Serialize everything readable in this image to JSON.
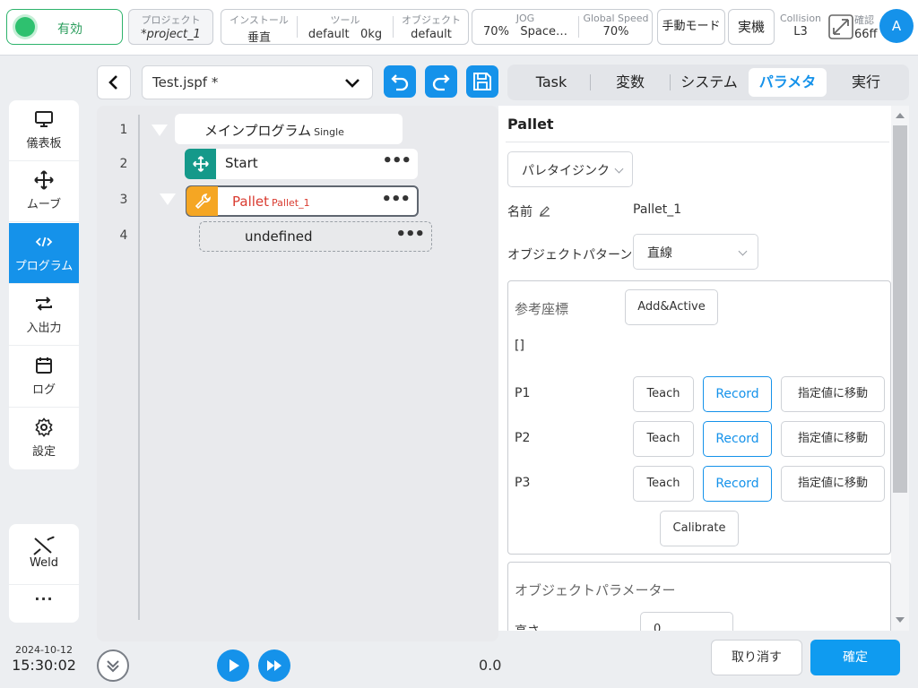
{
  "status": {
    "enable_label": "有効"
  },
  "project": {
    "caption": "プロジェクト",
    "value": "*project_1"
  },
  "install": {
    "caption": "インストール",
    "value": "垂直"
  },
  "tool": {
    "caption": "ツール",
    "value": "default",
    "weight": "0kg"
  },
  "object": {
    "caption": "オブジェクト",
    "value": "default"
  },
  "jog": {
    "caption": "JOG",
    "value": "70%",
    "space": "Space…"
  },
  "global_speed": {
    "caption": "Global Speed",
    "value": "70%"
  },
  "mode_button": "手動モード",
  "machine_button": "実機",
  "collision": {
    "caption": "Collision",
    "value": "L3"
  },
  "confirm": {
    "caption": "確認",
    "value": "66ff"
  },
  "user": {
    "avatar": "A"
  },
  "sidebar": {
    "items": [
      {
        "label": "儀表板",
        "icon": "monitor-icon"
      },
      {
        "label": "ムーブ",
        "icon": "move-icon"
      },
      {
        "label": "プログラム",
        "icon": "code-icon",
        "active": true
      },
      {
        "label": "入出力",
        "icon": "io-icon"
      },
      {
        "label": "ログ",
        "icon": "calendar-icon"
      },
      {
        "label": "設定",
        "icon": "gear-icon"
      }
    ],
    "weld_label": "Weld",
    "more_label": "···"
  },
  "datetime": {
    "date": "2024-10-12",
    "time": "15:30:02"
  },
  "editor": {
    "file_name": "Test.jspf *",
    "lines": [
      {
        "no": "1",
        "label": "メインプログラム",
        "sub": "Single"
      },
      {
        "no": "2",
        "label": "Start"
      },
      {
        "no": "3",
        "label": "Pallet",
        "sub": "Pallet_1"
      },
      {
        "no": "4",
        "label": "undefined"
      }
    ],
    "dots": "•••",
    "speed_value": "0.0"
  },
  "tabs": [
    "Task",
    "変数",
    "システム",
    "パラメタ",
    "実行"
  ],
  "active_tab": "パラメタ",
  "params": {
    "title": "Pallet",
    "type_select": "パレタイジンク",
    "name_label": "名前",
    "name_value": "Pallet_1",
    "pattern_label": "オブジェクトパターン",
    "pattern_value": "直線",
    "ref_label": "参考座標",
    "add_active": "Add&Active",
    "ref_value": "[]",
    "points": [
      {
        "label": "P1"
      },
      {
        "label": "P2"
      },
      {
        "label": "P3"
      }
    ],
    "teach_label": "Teach",
    "record_label": "Record",
    "move_label": "指定値に移動",
    "calibrate_label": "Calibrate",
    "obj_param_label": "オブジェクトパラメーター",
    "height_label": "高さ",
    "height_value": "0"
  },
  "footer": {
    "cancel": "取り消す",
    "ok": "確定"
  },
  "colors": {
    "accent": "#1592ea",
    "enabled": "#2ec16f",
    "pallet": "#f5a623",
    "start": "#15998a",
    "error_text": "#d93b30"
  }
}
